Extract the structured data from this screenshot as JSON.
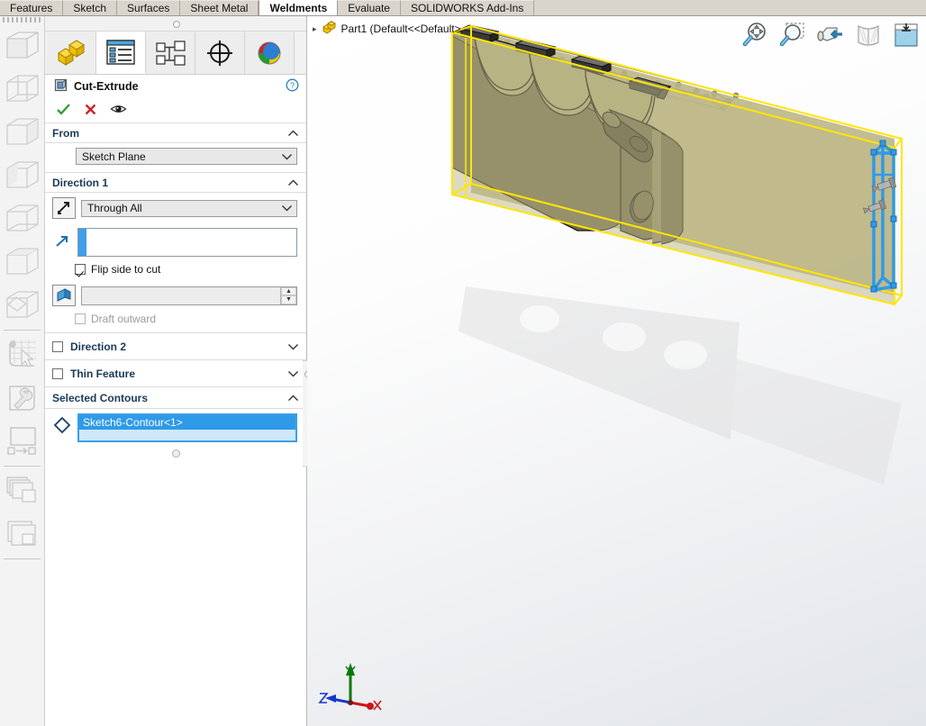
{
  "app": {
    "name": "SOLIDWORKS",
    "ribbon_tabs": [
      {
        "label": "Features",
        "active": false
      },
      {
        "label": "Sketch",
        "active": false
      },
      {
        "label": "Surfaces",
        "active": false
      },
      {
        "label": "Sheet Metal",
        "active": false
      },
      {
        "label": "Weldments",
        "active": true
      },
      {
        "label": "Evaluate",
        "active": false
      },
      {
        "label": "SOLIDWORKS Add-Ins",
        "active": false
      }
    ]
  },
  "left_rail": {
    "items": [
      {
        "name": "view-orientation-isometric-icon"
      },
      {
        "name": "view-orientation-trimetric-icon"
      },
      {
        "name": "view-orientation-dimetric-icon"
      },
      {
        "name": "view-orientation-left-icon"
      },
      {
        "name": "view-orientation-front-icon"
      },
      {
        "name": "view-orientation-top-icon"
      },
      {
        "name": "view-orientation-normal-to-icon"
      },
      {
        "name": "sketch-cursor-icon"
      },
      {
        "name": "tools-wrench-icon"
      },
      {
        "name": "window-transfer-icon"
      },
      {
        "name": "tile-windows-icon"
      },
      {
        "name": "cascade-windows-icon"
      }
    ]
  },
  "property_manager": {
    "tabs": [
      {
        "name": "feature-manager-tab",
        "active": false
      },
      {
        "name": "property-manager-tab",
        "active": true
      },
      {
        "name": "configuration-manager-tab",
        "active": false
      },
      {
        "name": "dimxpert-manager-tab",
        "active": false
      },
      {
        "name": "display-manager-tab",
        "active": false
      }
    ],
    "title": "Cut-Extrude",
    "title_icon": "cut-extrude-icon",
    "help_icon": "help-icon",
    "actions": [
      {
        "name": "ok-button",
        "glyph": "✓",
        "color": "#1f9d28"
      },
      {
        "name": "cancel-button",
        "glyph": "✕",
        "color": "#cf2222"
      },
      {
        "name": "preview-button",
        "glyph": "eye",
        "color": "#333333"
      }
    ],
    "from": {
      "header": "From",
      "value": "Sketch Plane",
      "collapse_glyph": "∧"
    },
    "direction1": {
      "header": "Direction 1",
      "collapse_glyph": "∧",
      "reverse_direction_icon": "reverse-direction-icon",
      "end_condition": "Through All",
      "depth_icon": "direction-arrow-icon",
      "depth_value": "",
      "flip_side_to_cut": {
        "label": "Flip side to cut",
        "checked": true
      },
      "draft_icon": "draft-angle-icon",
      "draft_value": "",
      "draft_outward": {
        "label": "Draft outward",
        "checked": false,
        "disabled": true
      }
    },
    "direction2": {
      "header": "Direction 2",
      "checked": false,
      "collapse_glyph": "∨"
    },
    "thin_feature": {
      "header": "Thin Feature",
      "checked": false,
      "collapse_glyph": "∨"
    },
    "selected_contours": {
      "header": "Selected Contours",
      "collapse_glyph": "∧",
      "contour_icon": "contour-diamond-icon",
      "items": [
        "Sketch6-Contour<1>"
      ]
    }
  },
  "viewport": {
    "tree_root": "Part1  (Default<<Default>...",
    "tree_icon": "part-icon",
    "tree_expand_glyph": "▸",
    "toolbar": [
      {
        "name": "zoom-to-fit-icon"
      },
      {
        "name": "zoom-to-area-icon"
      },
      {
        "name": "zoom-in-out-icon"
      },
      {
        "name": "section-view-icon"
      },
      {
        "name": "view-orientation-icon"
      }
    ],
    "triad": {
      "y_label": "Y",
      "y_color": "#0a7a0a",
      "x_label": "X",
      "x_color": "#cc1414",
      "z_label": "Z",
      "z_color": "#1437cc"
    },
    "colors": {
      "preview_box": "#ffe600",
      "body_olive": "#6e6b4e",
      "body_light": "#b3ae7e",
      "selection_blue": "#2f9ae8",
      "sketch_gray": "#6f6f6f"
    }
  }
}
